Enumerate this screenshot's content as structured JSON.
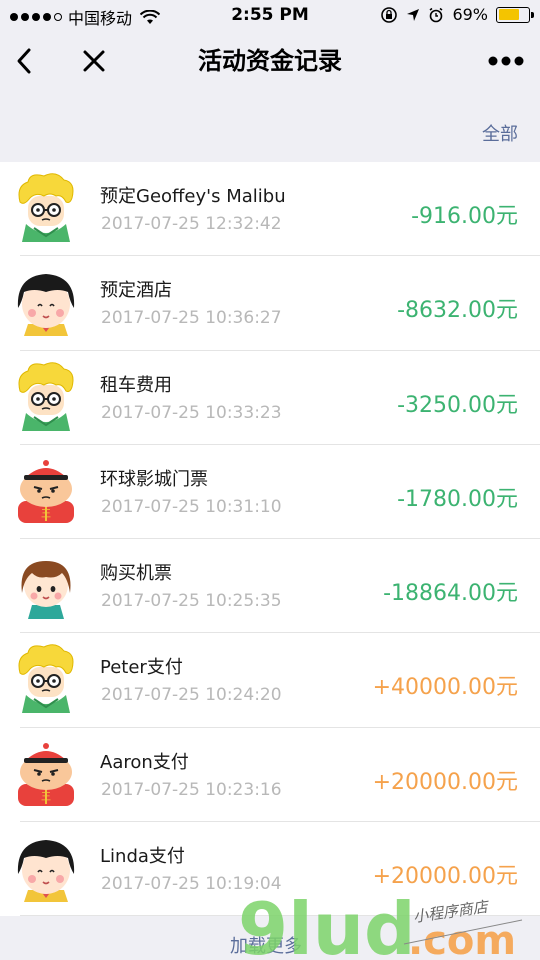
{
  "status_bar": {
    "carrier": "中国移动",
    "time": "2:55 PM",
    "battery": "69%",
    "battery_level": 0.69
  },
  "nav": {
    "title": "活动资金记录"
  },
  "filter": {
    "label": "全部"
  },
  "records": [
    {
      "title": "预定Geoffey's Malibu",
      "time": "2017-07-25 12:32:42",
      "amount": "-916.00元",
      "type": "negative",
      "avatar": "curly-hair-glasses-avatar"
    },
    {
      "title": "预定酒店",
      "time": "2017-07-25 10:36:27",
      "amount": "-8632.00元",
      "type": "negative",
      "avatar": "bob-haircut-girl-avatar"
    },
    {
      "title": "租车费用",
      "time": "2017-07-25 10:33:23",
      "amount": "-3250.00元",
      "type": "negative",
      "avatar": "curly-hair-glasses-avatar"
    },
    {
      "title": "环球影城门票",
      "time": "2017-07-25 10:31:10",
      "amount": "-1780.00元",
      "type": "negative",
      "avatar": "red-hat-boy-avatar"
    },
    {
      "title": "购买机票",
      "time": "2017-07-25 10:25:35",
      "amount": "-18864.00元",
      "type": "negative",
      "avatar": "brown-hair-girl-avatar"
    },
    {
      "title": "Peter支付",
      "time": "2017-07-25 10:24:20",
      "amount": "+40000.00元",
      "type": "positive",
      "avatar": "curly-hair-glasses-avatar"
    },
    {
      "title": "Aaron支付",
      "time": "2017-07-25 10:23:16",
      "amount": "+20000.00元",
      "type": "positive",
      "avatar": "red-hat-boy-avatar"
    },
    {
      "title": "Linda支付",
      "time": "2017-07-25 10:19:04",
      "amount": "+20000.00元",
      "type": "positive",
      "avatar": "bob-haircut-girl-avatar"
    }
  ],
  "load_more": "加载更多",
  "watermark": {
    "brand": "9lud",
    "domain": ".com",
    "tagline": "小程序商店"
  },
  "colors": {
    "negative": "#3cb371",
    "positive": "#f5a24c",
    "link": "#5a6d9a",
    "background": "#efeff4"
  }
}
